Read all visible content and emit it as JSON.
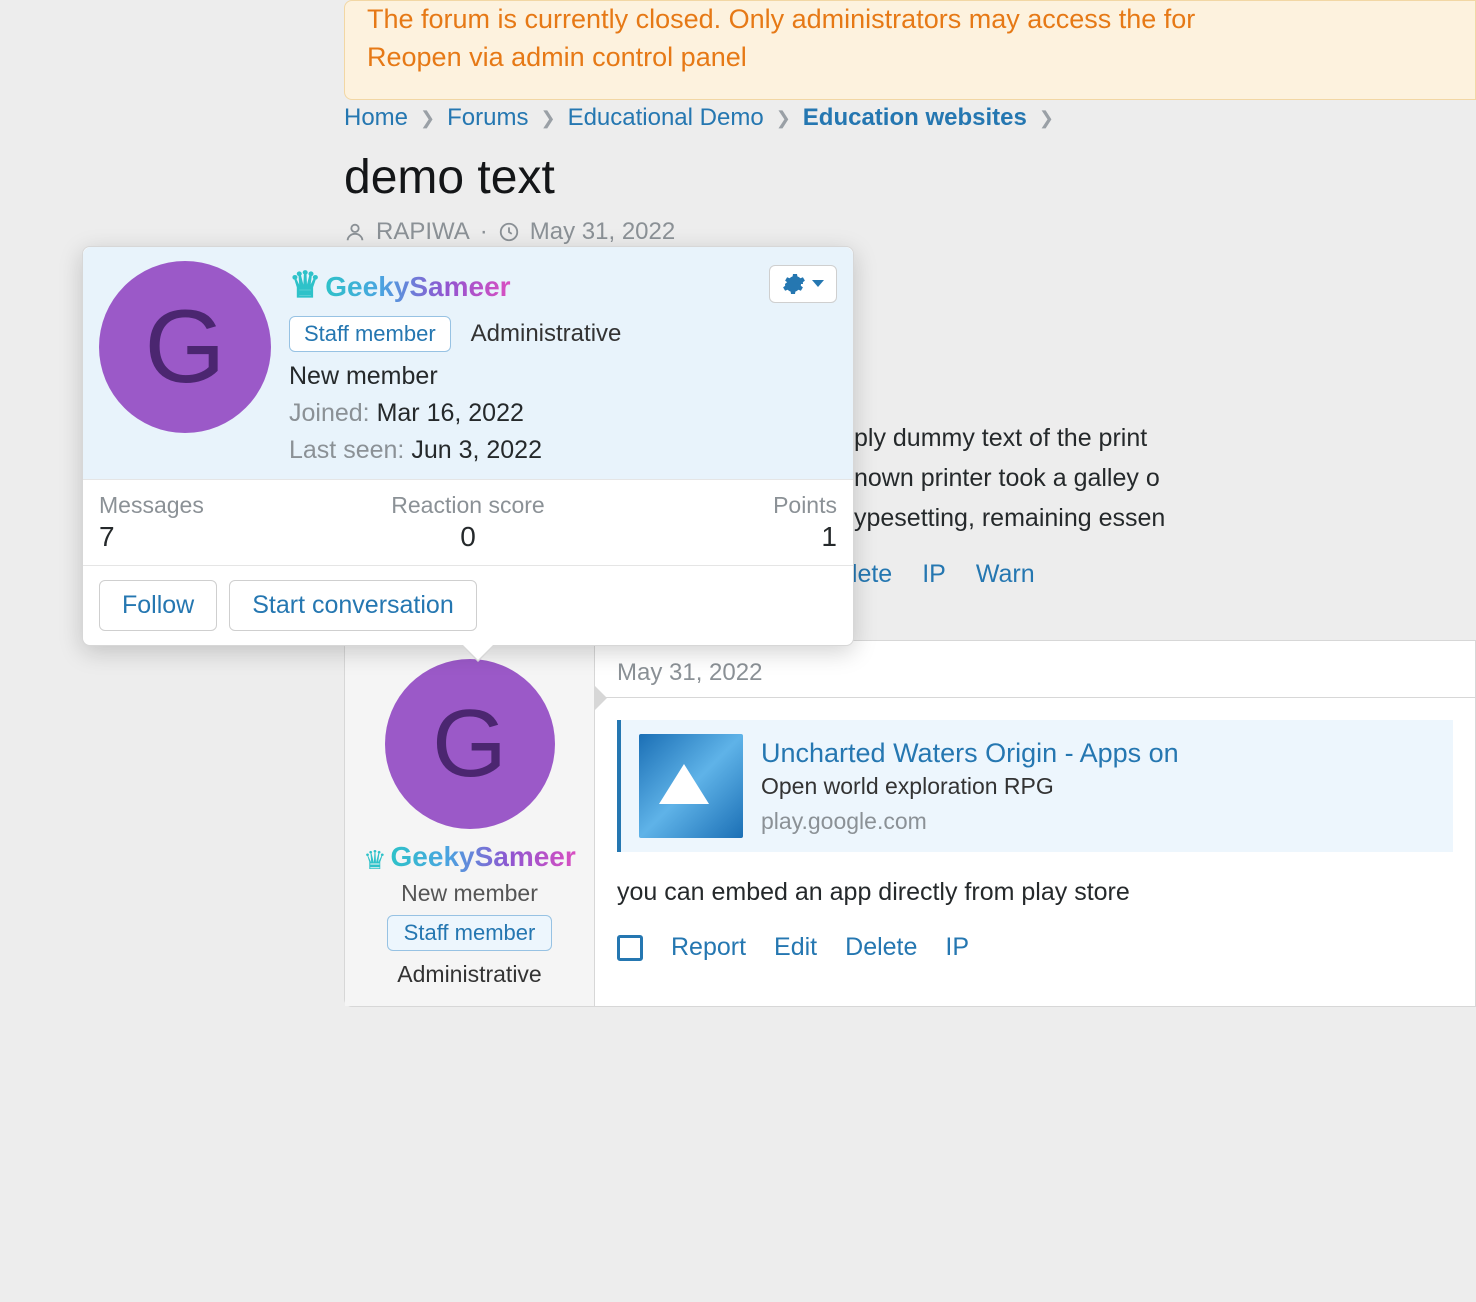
{
  "alert": {
    "line1": "The forum is currently closed. Only administrators may access the for",
    "line2": "Reopen via admin control panel"
  },
  "breadcrumb": {
    "home": "Home",
    "forums": "Forums",
    "demo": "Educational Demo",
    "current": "Education websites"
  },
  "page_title": "demo text",
  "meta": {
    "author": "RAPIWA",
    "date": "May 31, 2022",
    "separator": " · "
  },
  "body_snippet": "ply dummy text of the print\nnown printer took a galley o\nypesetting, remaining essen",
  "top_actions": {
    "delete": "elete",
    "ip": "IP",
    "warn": "Warn"
  },
  "post": {
    "avatar_letter": "G",
    "username": "GeekySameer",
    "user_title": "New member",
    "staff_badge": "Staff member",
    "admin_label": "Administrative",
    "date": "May 31, 2022",
    "embed": {
      "title": "Uncharted Waters Origin - Apps on ",
      "subtitle": "Open world exploration RPG",
      "domain": "play.google.com"
    },
    "body": "you can embed an app directly from play store ",
    "actions": {
      "report": "Report",
      "edit": "Edit",
      "delete": "Delete",
      "ip": "IP"
    }
  },
  "popover": {
    "avatar_letter": "G",
    "username": "GeekySameer",
    "staff_badge": "Staff member",
    "admin_label": "Administrative",
    "new_member": "New member",
    "joined_label": "Joined:",
    "joined_value": "Mar 16, 2022",
    "lastseen_label": "Last seen:",
    "lastseen_value": "Jun 3, 2022",
    "stats": {
      "messages_label": "Messages",
      "messages_value": "7",
      "reaction_label": "Reaction score",
      "reaction_value": "0",
      "points_label": "Points",
      "points_value": "1"
    },
    "follow": "Follow",
    "start_convo": "Start conversation"
  }
}
